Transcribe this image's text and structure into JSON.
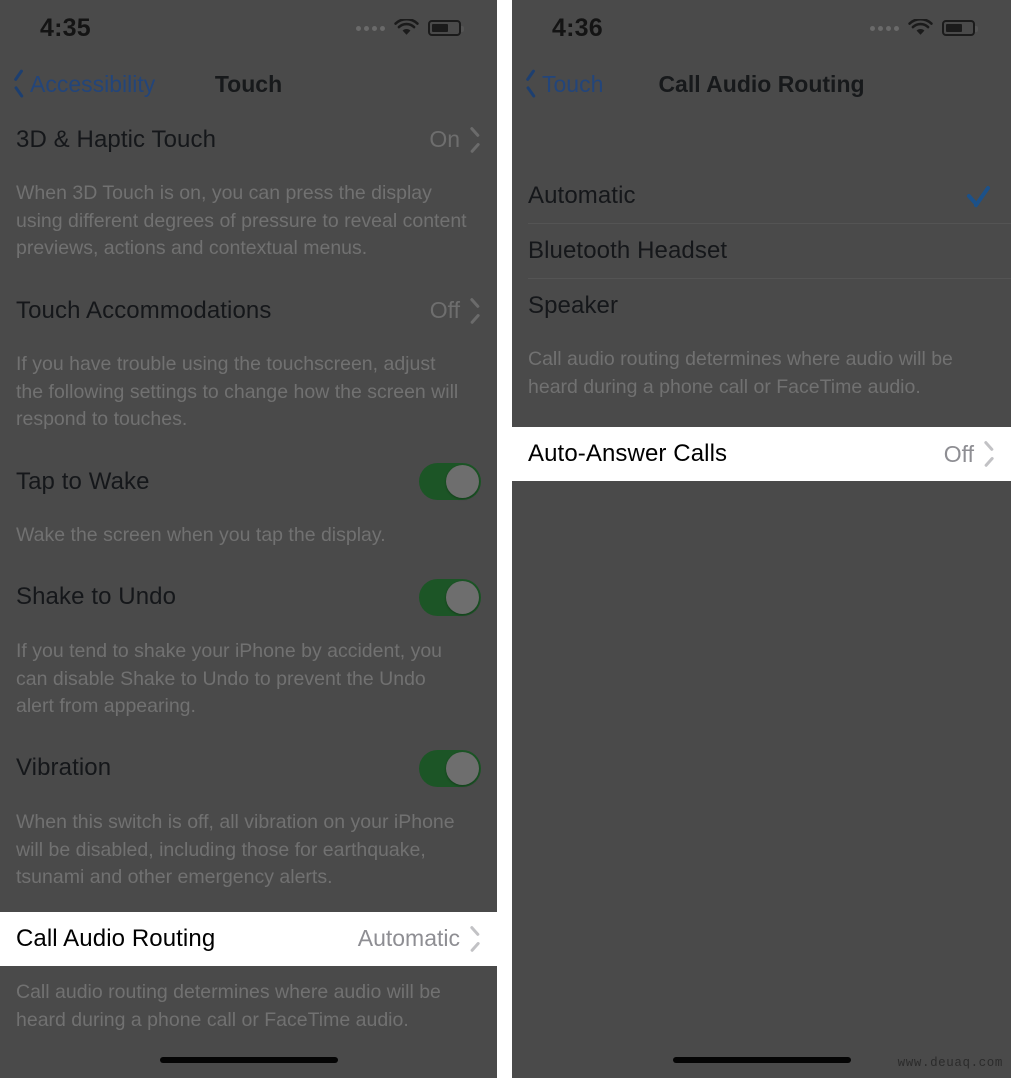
{
  "left_screen": {
    "status_bar": {
      "time": "4:35",
      "signal_icon": "signal-dots-icon",
      "wifi_icon": "wifi-icon",
      "battery_icon": "battery-icon"
    },
    "nav": {
      "back_label": "Accessibility",
      "title": "Touch",
      "back_icon": "chevron-left-icon"
    },
    "rows": [
      {
        "label": "3D & Haptic Touch",
        "value": "On",
        "accessory": "chevron-right-icon"
      },
      {
        "label": "Touch Accommodations",
        "value": "Off",
        "accessory": "chevron-right-icon"
      },
      {
        "label": "Tap to Wake",
        "value": "",
        "accessory": "toggle-on"
      },
      {
        "label": "Shake to Undo",
        "value": "",
        "accessory": "toggle-on"
      },
      {
        "label": "Vibration",
        "value": "",
        "accessory": "toggle-on"
      },
      {
        "label": "Call Audio Routing",
        "value": "Automatic",
        "accessory": "chevron-right-icon"
      }
    ],
    "footnotes": [
      "When 3D Touch is on, you can press the display using different degrees of pressure to reveal content previews, actions and contextual menus.",
      "If you have trouble using the touchscreen, adjust the following settings to change how the screen will respond to touches.",
      "Wake the screen when you tap the display.",
      "If you tend to shake your iPhone by accident, you can disable Shake to Undo to prevent the Undo alert from appearing.",
      "When this switch is off, all vibration on your iPhone will be disabled, including those for earthquake, tsunami and other emergency alerts.",
      "Call audio routing determines where audio will be heard during a phone call or FaceTime audio."
    ]
  },
  "right_screen": {
    "status_bar": {
      "time": "4:36",
      "signal_icon": "signal-dots-icon",
      "wifi_icon": "wifi-icon",
      "battery_icon": "battery-icon"
    },
    "nav": {
      "back_label": "Touch",
      "title": "Call Audio Routing",
      "back_icon": "chevron-left-icon"
    },
    "options": [
      {
        "label": "Automatic",
        "selected": true,
        "check_icon": "checkmark-icon"
      },
      {
        "label": "Bluetooth Headset",
        "selected": false,
        "check_icon": ""
      },
      {
        "label": "Speaker",
        "selected": false,
        "check_icon": ""
      }
    ],
    "footnote": "Call audio routing determines where audio will be heard during a phone call or FaceTime audio.",
    "auto_answer": {
      "label": "Auto-Answer Calls",
      "value": "Off",
      "accessory": "chevron-right-icon"
    }
  },
  "watermark": "www.deuaq.com",
  "colors": {
    "dim_overlay": "#4a4a4a",
    "toggle_on": "#1c5526",
    "accent_blue": "#23457a",
    "checkmark_blue": "#1c5189",
    "highlight_row_bg": "#ffffff"
  }
}
